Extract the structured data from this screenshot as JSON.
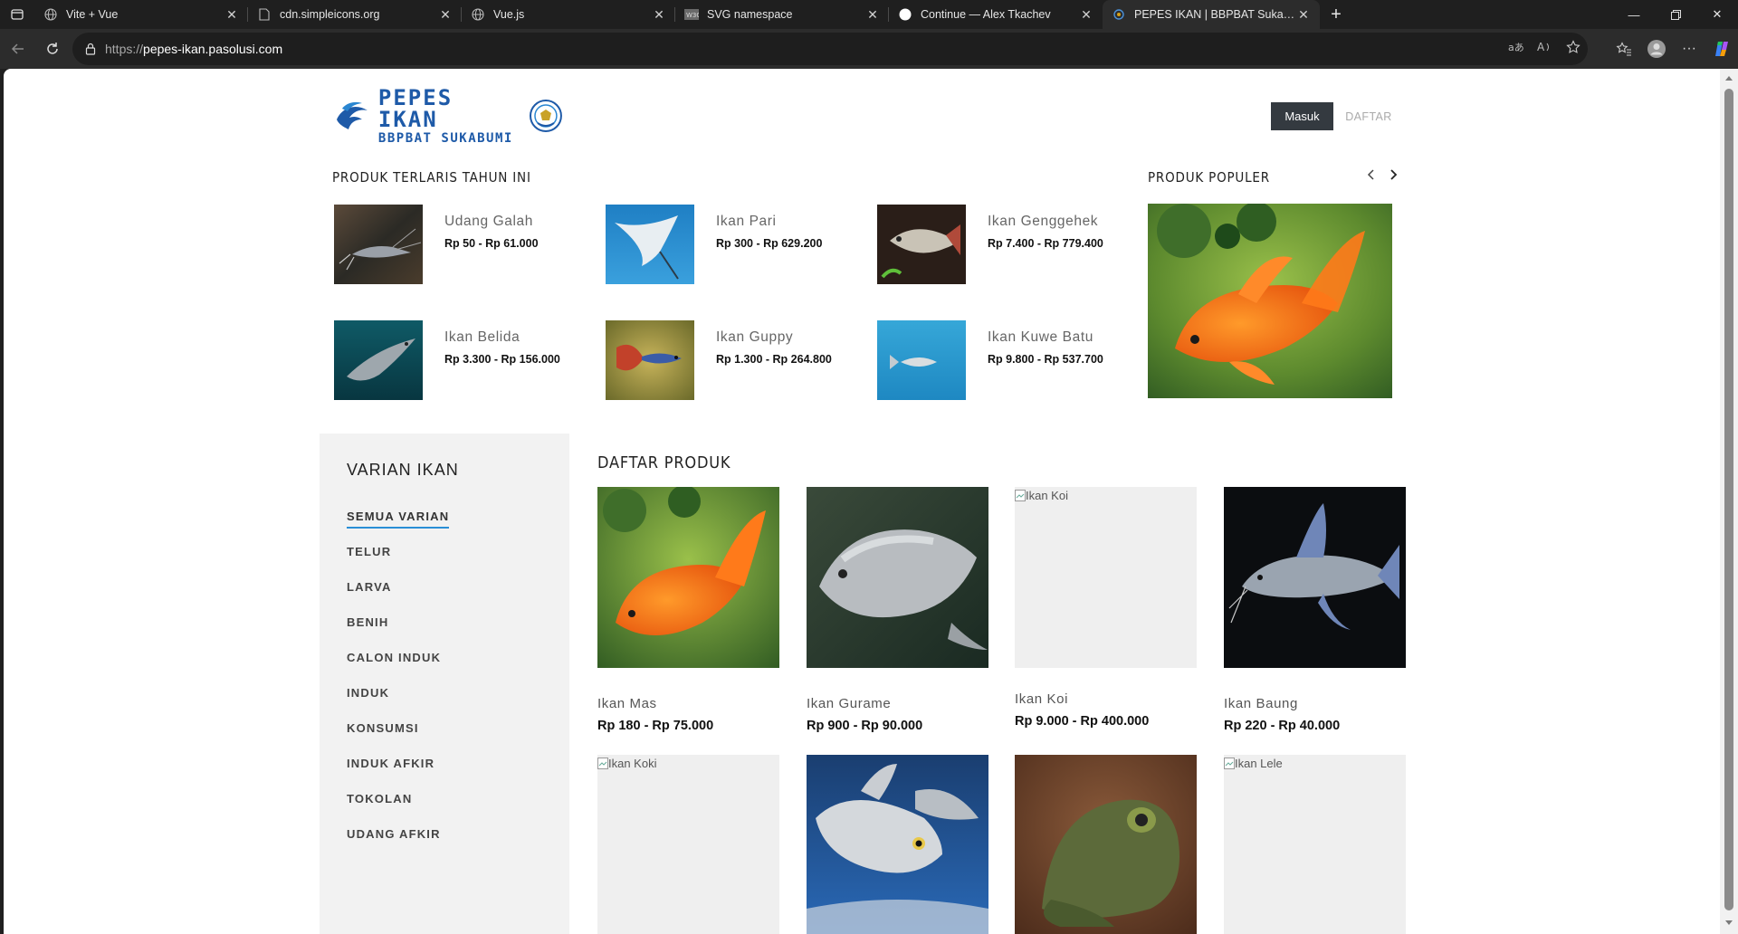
{
  "browser": {
    "tabs": [
      {
        "title": "Vite + Vue"
      },
      {
        "title": "cdn.simpleicons.org"
      },
      {
        "title": "Vue.js"
      },
      {
        "title": "SVG namespace"
      },
      {
        "title": "Continue — Alex Tkachev"
      },
      {
        "title": "PEPES IKAN | BBPBAT Sukabumi"
      }
    ],
    "url_scheme": "https://",
    "url_host": "pepes-ikan.pasolusi.com",
    "colors": {
      "chrome_bg": "#1f1f1f",
      "active_tab": "#2c2c2c"
    }
  },
  "header": {
    "logo_line1": "PEPES IKAN",
    "logo_line2": "BBPBAT SUKABUMI",
    "login_label": "Masuk",
    "register_label": "DAFTAR"
  },
  "bestsellers": {
    "title": "PRODUK TERLARIS TAHUN INI",
    "items": [
      {
        "name": "Udang Galah",
        "price": "Rp 50 - Rp 61.000"
      },
      {
        "name": "Ikan Pari",
        "price": "Rp 300 - Rp 629.200"
      },
      {
        "name": "Ikan Genggehek",
        "price": "Rp 7.400 - Rp 779.400"
      },
      {
        "name": "Ikan Belida",
        "price": "Rp 3.300 - Rp 156.000"
      },
      {
        "name": "Ikan Guppy",
        "price": "Rp 1.300 - Rp 264.800"
      },
      {
        "name": "Ikan Kuwe Batu",
        "price": "Rp 9.800 - Rp 537.700"
      }
    ]
  },
  "popular": {
    "title": "PRODUK POPULER"
  },
  "sidebar": {
    "title": "VARIAN IKAN",
    "items": [
      {
        "label": "SEMUA VARIAN"
      },
      {
        "label": "TELUR"
      },
      {
        "label": "LARVA"
      },
      {
        "label": "BENIH"
      },
      {
        "label": "CALON INDUK"
      },
      {
        "label": "INDUK"
      },
      {
        "label": "KONSUMSI"
      },
      {
        "label": "INDUK AFKIR"
      },
      {
        "label": "TOKOLAN"
      },
      {
        "label": "UDANG AFKIR"
      }
    ]
  },
  "products": {
    "title": "DAFTAR PRODUK",
    "items": [
      {
        "name": "Ikan Mas",
        "price": "Rp 180 - Rp 75.000"
      },
      {
        "name": "Ikan Gurame",
        "price": "Rp 900 - Rp 90.000"
      },
      {
        "name": "Ikan Koi",
        "price": "Rp 9.000 - Rp 400.000",
        "alt": "Ikan Koi"
      },
      {
        "name": "Ikan Baung",
        "price": "Rp 220 - Rp 40.000"
      },
      {
        "alt": "Ikan Koki"
      },
      {},
      {},
      {
        "alt": "Ikan Lele"
      }
    ]
  }
}
